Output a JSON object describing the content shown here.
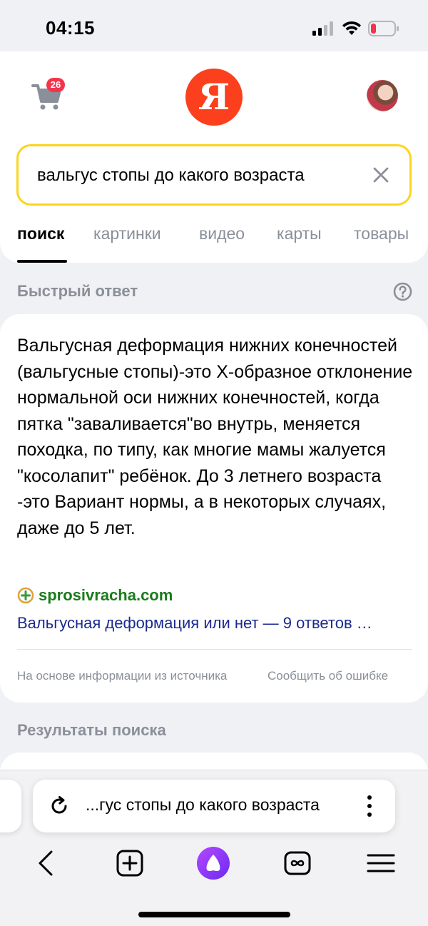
{
  "status_bar": {
    "time": "04:15"
  },
  "header": {
    "cart_count": "26",
    "logo_letter": "Я"
  },
  "search": {
    "query": "вальгус стопы до какого возраста"
  },
  "tabs": [
    {
      "label": "поиск",
      "active": true
    },
    {
      "label": "картинки"
    },
    {
      "label": "видео"
    },
    {
      "label": "карты"
    },
    {
      "label": "товары"
    }
  ],
  "quick_answer": {
    "section_title": "Быстрый ответ",
    "text": "Вальгусная деформация нижних конечностей (вальгусные стопы)-это Х-образное отклонение нормальной оси нижних конечностей, когда пятка \"заваливается\"во внутрь, меняется походка, по типу, как многие мамы жалуется \"косолапит\" ребёнок. До 3 летнего возраста -это Вариант нормы, а в некоторых случаях, даже до 5 лет.",
    "source_domain": "sprosivracha.com",
    "source_link": "Вальгусная деформация или нет — 9 ответов …",
    "footnote": "На основе информации из источника",
    "report_error": "Сообщить об ошибке"
  },
  "results": {
    "section_title": "Результаты поиска"
  },
  "browser": {
    "address": "...гус стопы до какого возраста"
  },
  "colors": {
    "yandex_red": "#fc3f1d",
    "search_border": "#fbd51e",
    "alice_purple": "#8a3bf0",
    "source_green": "#1b7b1b",
    "link_blue": "#1a2a8f"
  }
}
